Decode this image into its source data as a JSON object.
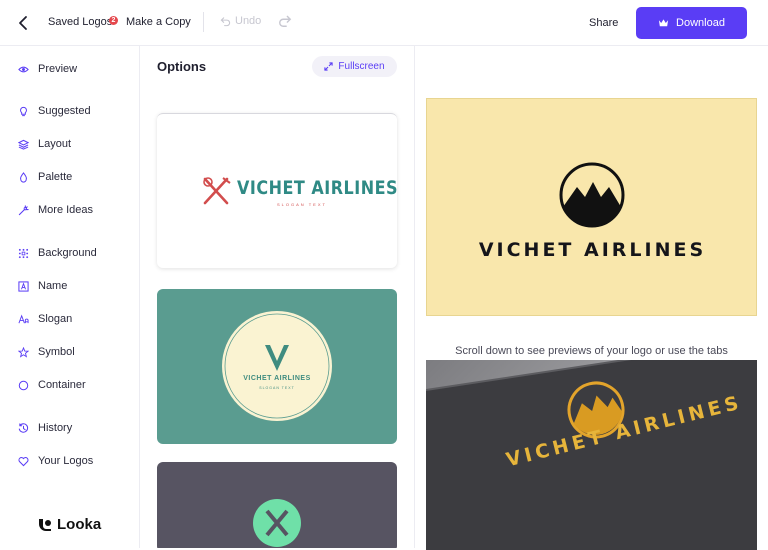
{
  "header": {
    "saved_logos": "Saved Logos",
    "saved_count": "2",
    "make_copy": "Make a Copy",
    "undo": "Undo",
    "share": "Share",
    "download": "Download"
  },
  "sidebar": {
    "items": [
      {
        "label": "Preview",
        "icon": "eye-icon"
      },
      {
        "label": "Suggested",
        "icon": "lightbulb-icon"
      },
      {
        "label": "Layout",
        "icon": "layers-icon"
      },
      {
        "label": "Palette",
        "icon": "droplet-icon"
      },
      {
        "label": "More Ideas",
        "icon": "magic-wand-icon"
      },
      {
        "label": "Background",
        "icon": "grid-dots-icon"
      },
      {
        "label": "Name",
        "icon": "letter-box-icon"
      },
      {
        "label": "Slogan",
        "icon": "text-aa-icon"
      },
      {
        "label": "Symbol",
        "icon": "star-icon"
      },
      {
        "label": "Container",
        "icon": "circle-icon"
      },
      {
        "label": "History",
        "icon": "history-icon"
      },
      {
        "label": "Your Logos",
        "icon": "heart-icon"
      }
    ],
    "brand": "Looka"
  },
  "options": {
    "title": "Options",
    "fullscreen": "Fullscreen",
    "cards": [
      {
        "name": "VICHET AIRLINES",
        "slogan": "SLOGAN TEXT",
        "bg": "#ffffff",
        "text_color": "#2f8a85",
        "slogan_color": "#d24d4d"
      },
      {
        "name": "VICHET AIRLINES",
        "slogan": "SLOGAN TEXT",
        "bg": "#5a9c90",
        "text_color": "#3f8c80",
        "badge_color": "#faf3d2"
      },
      {
        "bg": "#575462",
        "symbol_color": "#6fe0a8"
      }
    ]
  },
  "preview": {
    "name": "VICHET AIRLINES",
    "bg": "#f9e7ac",
    "hint": "Scroll down to see previews of your logo or use the tabs",
    "mockup_name": "VICHET AIRLINES",
    "accent": "#5a3df5"
  }
}
